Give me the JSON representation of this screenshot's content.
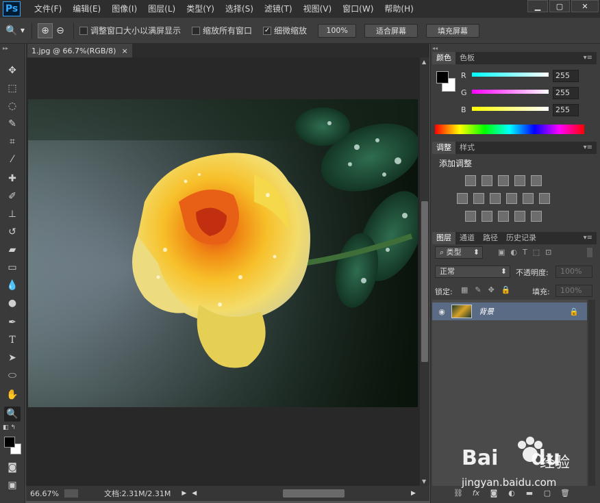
{
  "app": {
    "logo": "Ps"
  },
  "menu": [
    "文件(F)",
    "编辑(E)",
    "图像(I)",
    "图层(L)",
    "类型(Y)",
    "选择(S)",
    "滤镜(T)",
    "视图(V)",
    "窗口(W)",
    "帮助(H)"
  ],
  "window_controls": {
    "minimize": "▁",
    "maximize": "▢",
    "close": "✕"
  },
  "options": {
    "resize_windows": "调整窗口大小以满屏显示",
    "zoom_all": "缩放所有窗口",
    "scrubby_zoom": "细微缩放",
    "scrubby_checked": true,
    "btn_100": "100%",
    "btn_fit": "适合屏幕",
    "btn_fill": "填充屏幕"
  },
  "document": {
    "tab_title": "1.jpg @ 66.7%(RGB/8)",
    "tab_close": "×"
  },
  "status": {
    "zoom": "66.67%",
    "doc_info": "文档:2.31M/2.31M"
  },
  "color_panel": {
    "tabs": [
      "颜色",
      "色板"
    ],
    "r_label": "R",
    "g_label": "G",
    "b_label": "B",
    "r_value": "255",
    "g_value": "255",
    "b_value": "255"
  },
  "adjust_panel": {
    "tabs": [
      "调整",
      "样式"
    ],
    "title": "添加调整"
  },
  "layers_panel": {
    "tabs": [
      "图层",
      "通道",
      "路径",
      "历史记录"
    ],
    "filter_label": "类型",
    "blend_mode": "正常",
    "opacity_label": "不透明度:",
    "opacity_value": "100%",
    "lock_label": "锁定:",
    "fill_label": "填充:",
    "fill_value": "100%",
    "layer_name": "背景"
  },
  "colors": {
    "accent_ps": "#31a8ff",
    "layer_selected": "#5a6b85"
  },
  "watermark": {
    "brand": "Bai",
    "brand2": "du",
    "cn": "经验",
    "url": "jingyan.baidu.com"
  }
}
